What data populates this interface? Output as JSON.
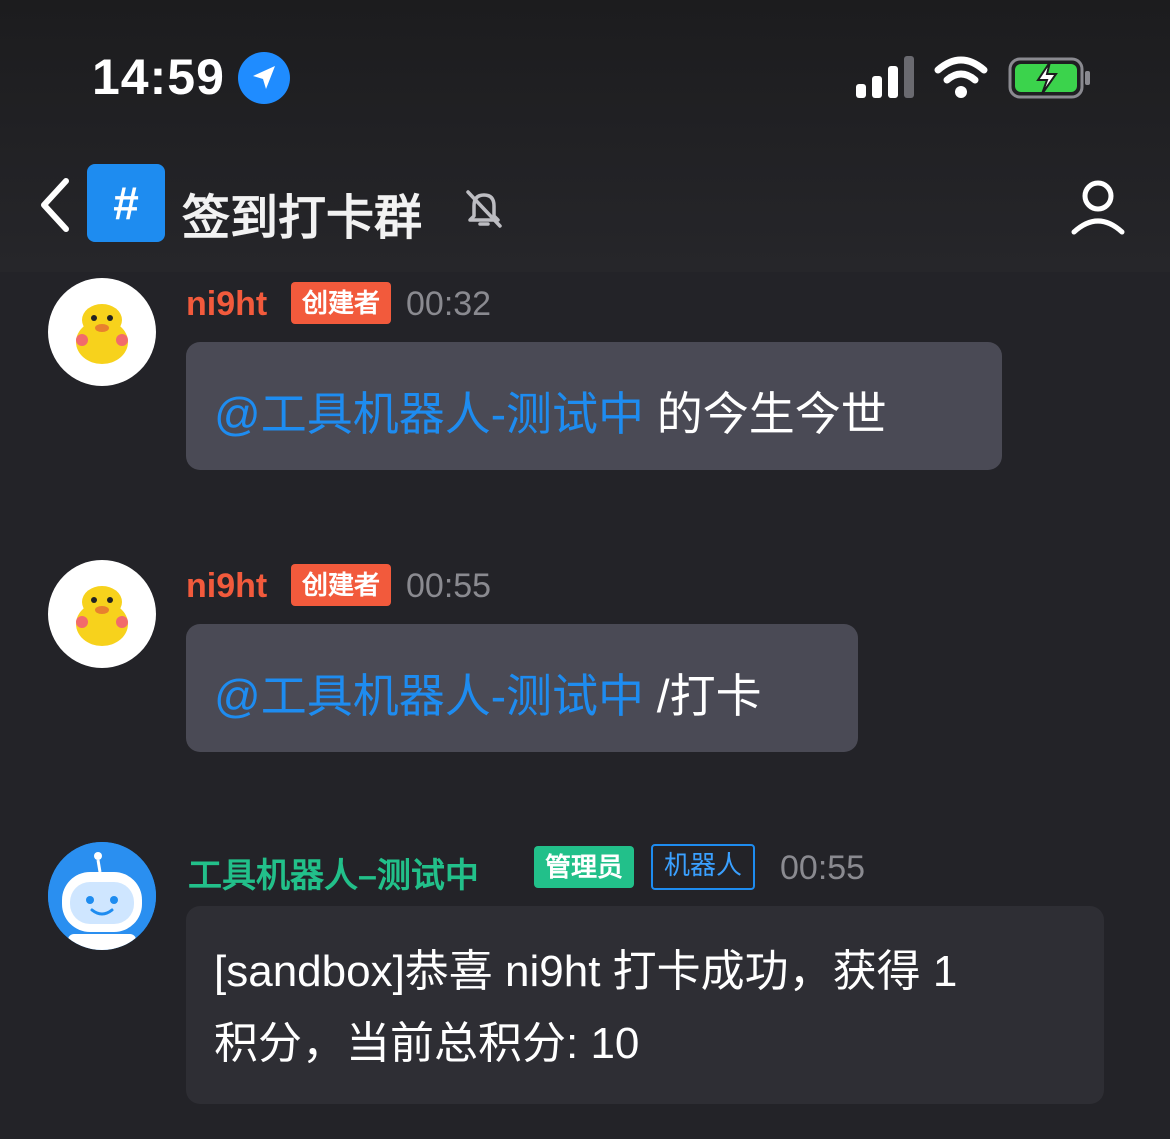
{
  "status_bar": {
    "time": "14:59"
  },
  "header": {
    "channel_title": "签到打卡群",
    "channel_symbol": "#"
  },
  "messages": [
    {
      "author": "ni9ht",
      "role_badge": "创建者",
      "time": "00:32",
      "mention": "@工具机器人-测试中",
      "text": " 的今生今世"
    },
    {
      "author": "ni9ht",
      "role_badge": "创建者",
      "time": "00:55",
      "mention": "@工具机器人-测试中",
      "text": " /打卡"
    },
    {
      "author": "工具机器人–测试中",
      "role_badge": "管理员",
      "bot_badge": "机器人",
      "time": "00:55",
      "text_line1": "[sandbox]恭喜 ni9ht 打卡成功，获得 1",
      "text_line2": "积分，当前总积分: 10"
    }
  ],
  "colors": {
    "accent_blue": "#1e8cf0",
    "creator_name": "#f25a3c",
    "bot_name": "#22c08a",
    "bubble": "#4a4a55",
    "background": "#232328"
  }
}
